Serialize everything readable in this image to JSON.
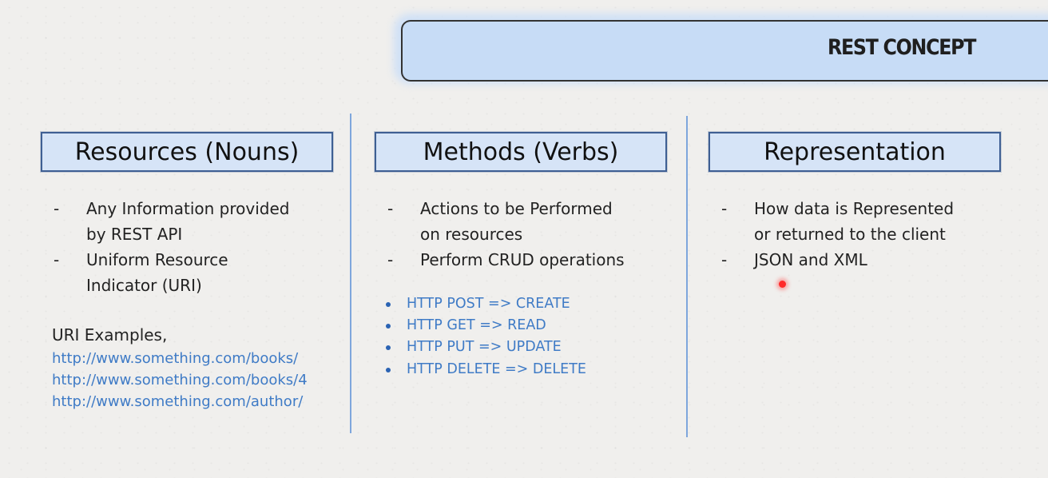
{
  "title": "REST CONCEPT",
  "columns": [
    {
      "heading": "Resources (Nouns)",
      "bullets": [
        {
          "dash": "-",
          "lines": [
            "Any Information provided",
            "by REST API"
          ]
        },
        {
          "dash": "-",
          "lines": [
            "Uniform Resource",
            "Indicator (URI)"
          ]
        }
      ],
      "examples_heading": "URI Examples,",
      "examples": [
        "http://www.something.com/books/",
        "http://www.something.com/books/4",
        "http://www.something.com/author/"
      ]
    },
    {
      "heading": "Methods (Verbs)",
      "bullets": [
        {
          "dash": "-",
          "lines": [
            "Actions to be Performed",
            "on resources"
          ]
        },
        {
          "dash": "-",
          "lines": [
            "Perform CRUD operations"
          ]
        }
      ],
      "http_methods": [
        "HTTP POST => CREATE",
        "HTTP GET => READ",
        "HTTP PUT => UPDATE",
        "HTTP DELETE => DELETE"
      ]
    },
    {
      "heading": "Representation",
      "bullets": [
        {
          "dash": "-",
          "lines": [
            "How data is Represented",
            "or returned to the client"
          ]
        },
        {
          "dash": "-",
          "lines": [
            "JSON and XML"
          ]
        }
      ]
    }
  ],
  "colors": {
    "banner_fill": "#c7dcf6",
    "heading_fill": "#d6e4f7",
    "heading_border": "#3e5f93",
    "link_blue": "#3f7bc6",
    "divider_blue": "#7ea6dc",
    "cursor_red": "#ff2a2a"
  }
}
